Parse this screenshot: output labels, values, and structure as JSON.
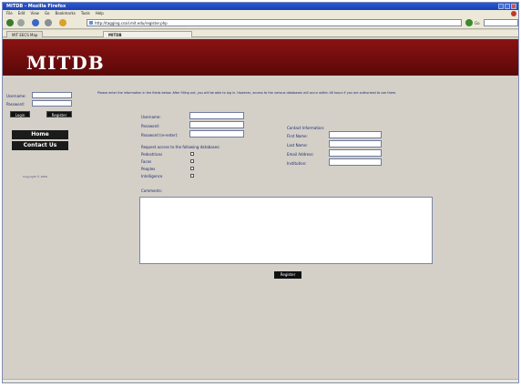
{
  "window": {
    "title": "MITDB - Mozilla Firefox"
  },
  "menubar": [
    "File",
    "Edit",
    "View",
    "Go",
    "Bookmarks",
    "Tools",
    "Help"
  ],
  "navbar": {
    "address_label": "",
    "url": "http://tagging.csail.mit.edu/register.php",
    "go_label": "Go",
    "search_label": "G"
  },
  "tabs": [
    {
      "label": "MIT EECS Map"
    },
    {
      "label": "MITDB"
    }
  ],
  "banner": {
    "title": "MITDB"
  },
  "sidebar": {
    "username_label": "Username:",
    "password_label": "Password:",
    "login_button": "Login",
    "register_button": "Register",
    "home_button": "Home",
    "contact_button": "Contact Us",
    "copyright": "Copyright © 2005"
  },
  "form": {
    "intro": "Please enter the information in the fields below. After filling out, you will be able to log in. However, access to the various databases will occur within 48 hours if you are authorized to use them.",
    "username_label": "Username:",
    "password_label": "Password:",
    "password_reenter_label": "Password (re-enter):",
    "contact_heading": "Contact Information:",
    "first_name_label": "First Name:",
    "last_name_label": "Last Name:",
    "email_label": "Email Address:",
    "institution_label": "Institution:",
    "databases_heading": "Request access to the following databases:",
    "databases": [
      "Pedestrians",
      "Faces",
      "Peoples",
      "Intelligence"
    ],
    "comments_label": "Comments:",
    "submit_label": "Register"
  }
}
